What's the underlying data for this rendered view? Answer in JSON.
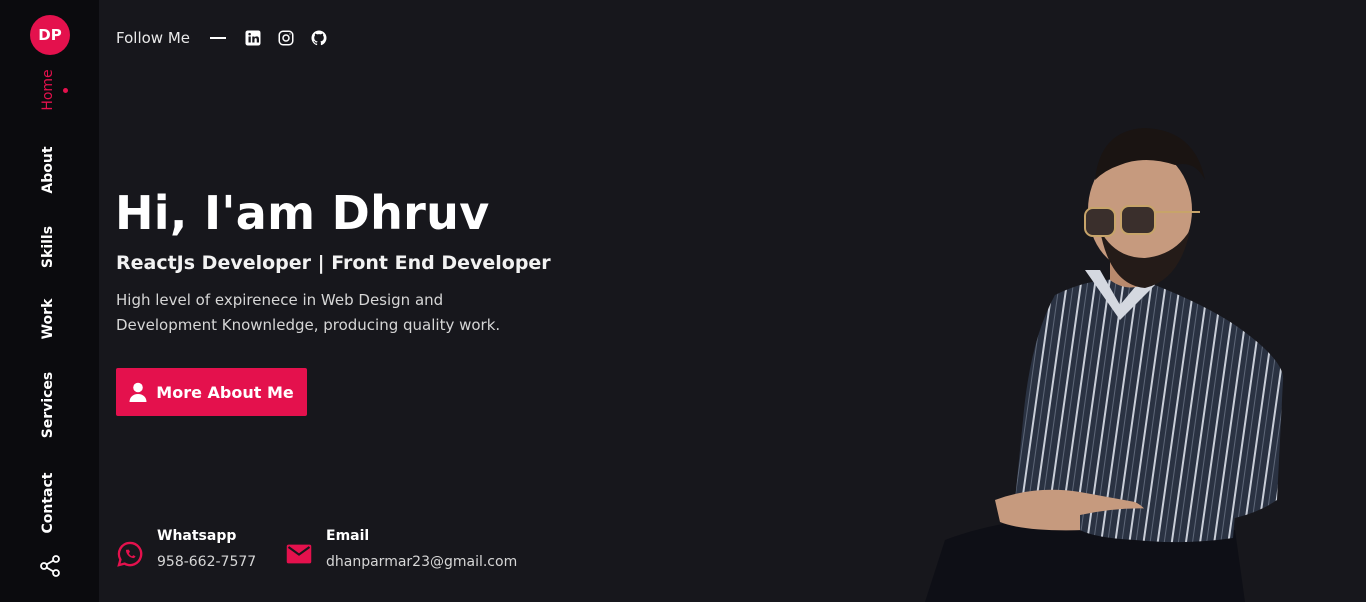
{
  "brand": {
    "initials": "DP",
    "color": "#e4114d"
  },
  "nav": {
    "items": [
      {
        "label": "Home",
        "active": true
      },
      {
        "label": "About"
      },
      {
        "label": "Skills"
      },
      {
        "label": "Work"
      },
      {
        "label": "Services"
      },
      {
        "label": "Contact"
      }
    ],
    "share_icon": "share-icon"
  },
  "follow": {
    "label": "Follow Me",
    "icons": [
      "linkedin-icon",
      "instagram-icon",
      "github-icon"
    ]
  },
  "hero": {
    "title": "Hi, I'am Dhruv",
    "subtitle": "ReactJs Developer | Front End Developer",
    "description": "High level of expirenece in Web Design and Development Knownledge, producing quality work.",
    "cta_label": "More About Me",
    "cta_icon": "user-icon"
  },
  "contacts": {
    "whatsapp": {
      "label": "Whatsapp",
      "value": "958-662-7577",
      "icon": "whatsapp-icon"
    },
    "email": {
      "label": "Email",
      "value": "dhanparmar23@gmail.com",
      "icon": "mail-icon"
    }
  },
  "colors": {
    "accent": "#e4114d",
    "background": "#17171c",
    "sidebar": "#0b0b0e"
  }
}
